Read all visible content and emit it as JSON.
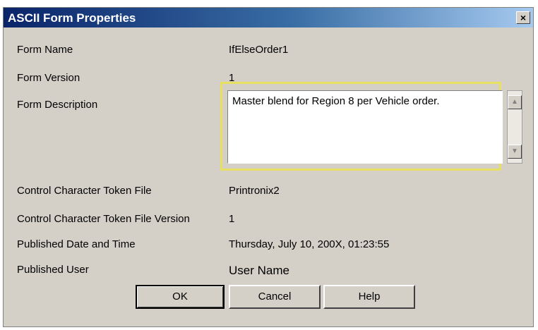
{
  "window": {
    "title": "ASCII Form Properties",
    "close_glyph": "×"
  },
  "fields": [
    {
      "label": "Form Name",
      "value": "IfElseOrder1"
    },
    {
      "label": "Form Version",
      "value": "1"
    },
    {
      "label": "Form Description",
      "value": "Master blend for Region 8 per Vehicle order."
    },
    {
      "label": "Control Character Token File",
      "value": "Printronix2"
    },
    {
      "label": "Control Character Token File Version",
      "value": "1"
    },
    {
      "label": "Published Date and Time",
      "value": "Thursday, July 10, 200X, 01:23:55"
    },
    {
      "label": "Published User",
      "value": "User Name"
    }
  ],
  "buttons": {
    "ok": "OK",
    "cancel": "Cancel",
    "help": "Help"
  },
  "scroll": {
    "up": "▲",
    "down": "▼"
  }
}
